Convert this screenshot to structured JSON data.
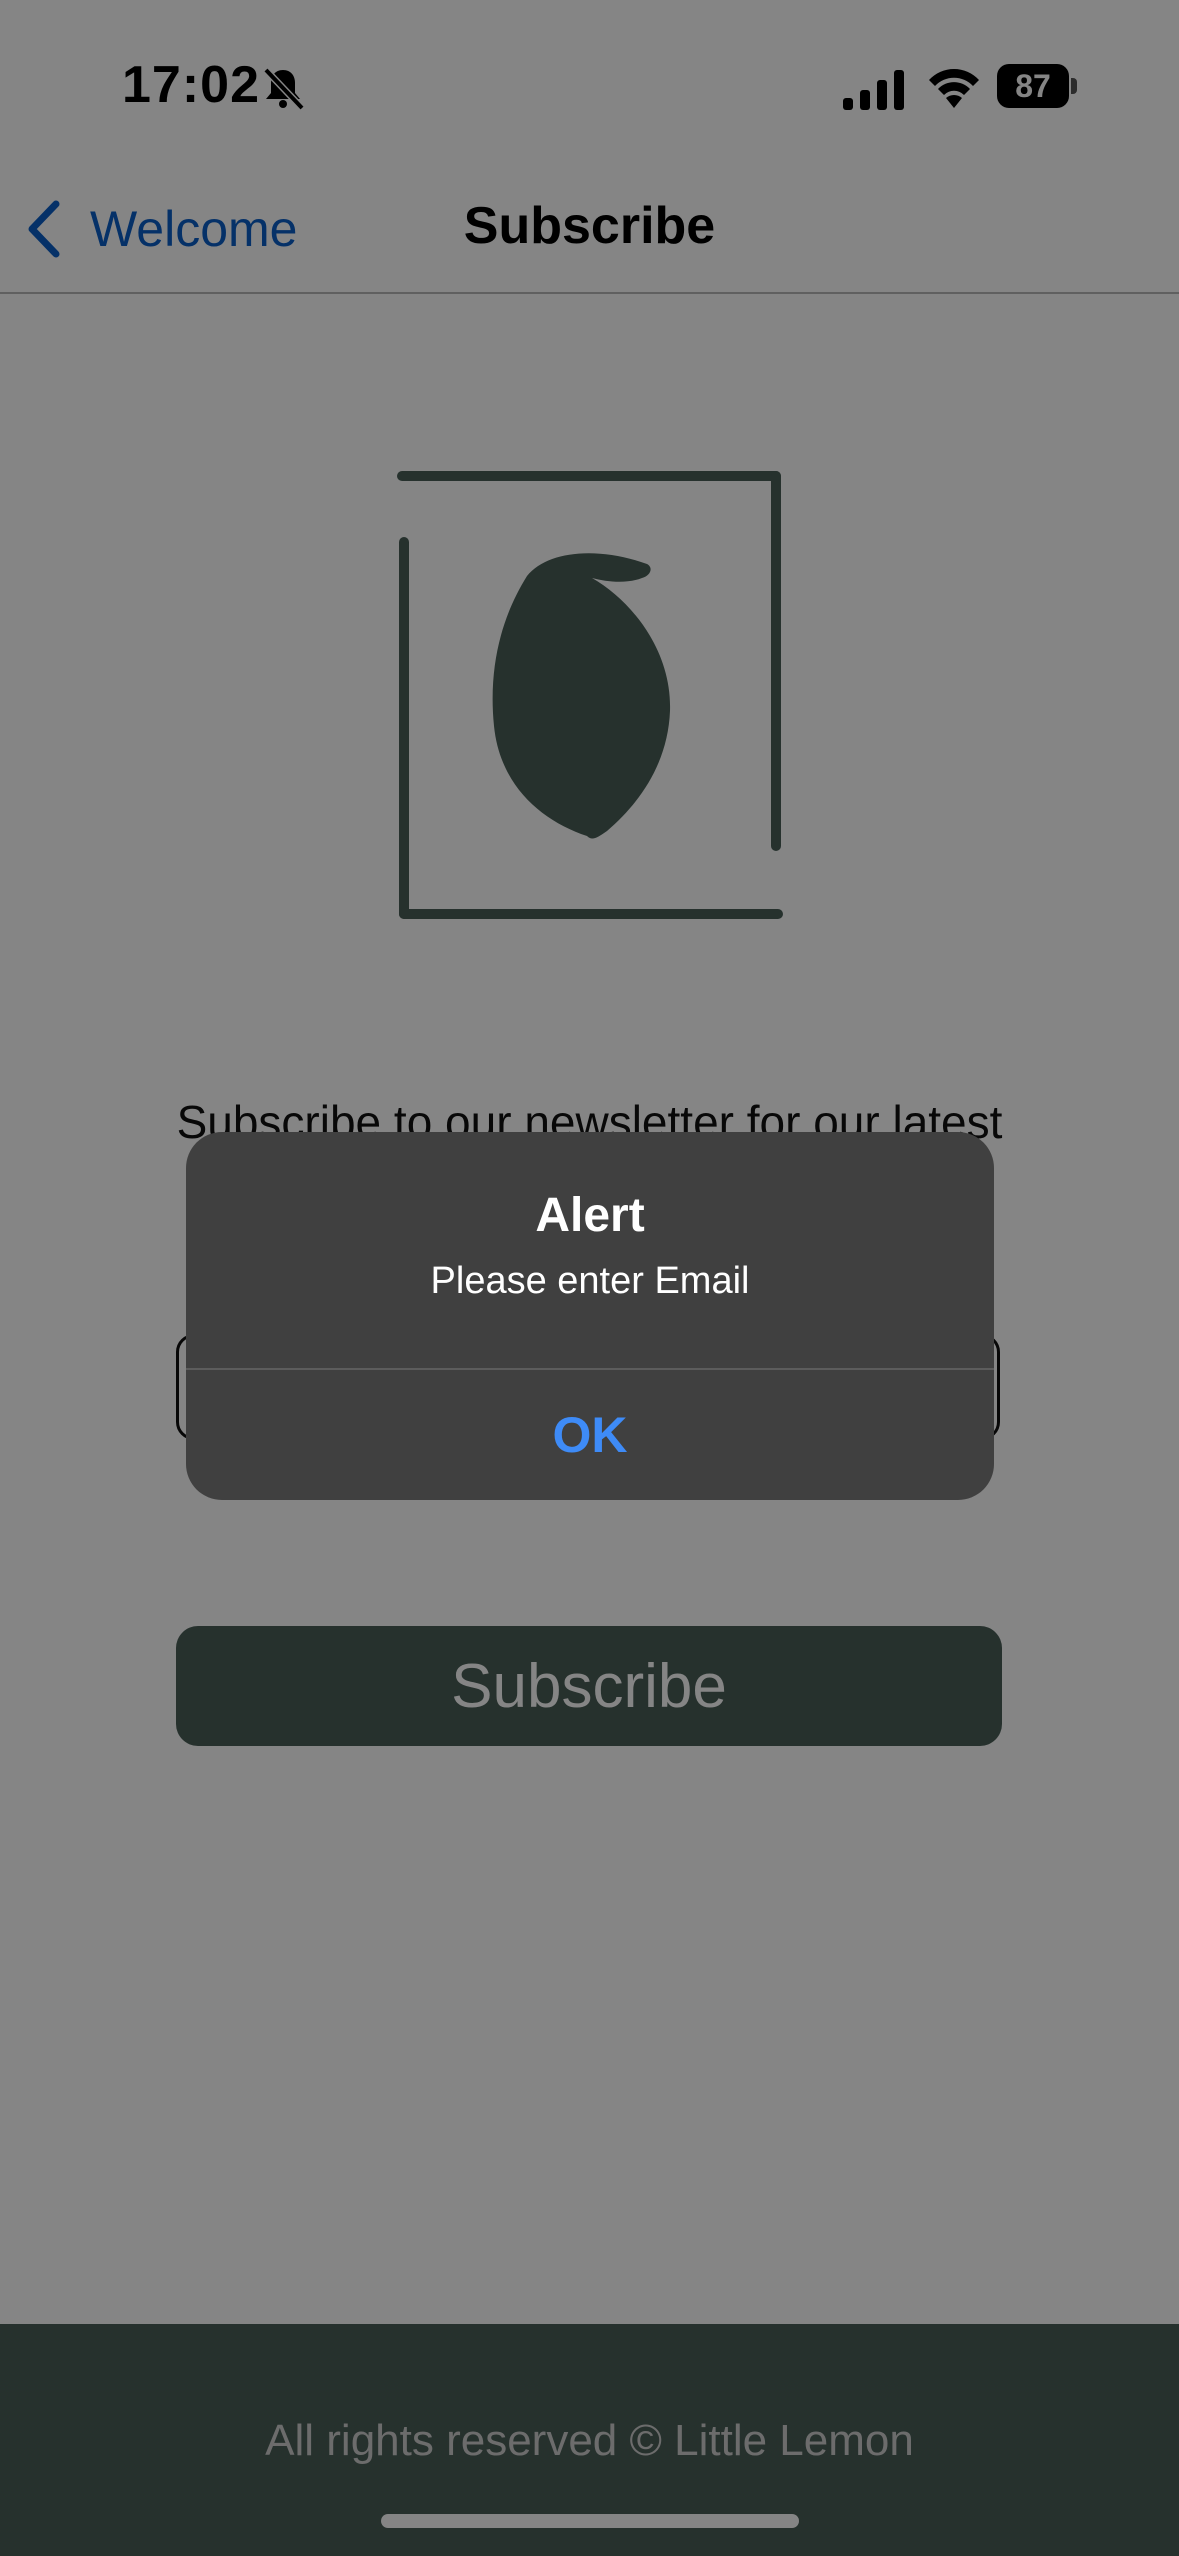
{
  "status_bar": {
    "time": "17:02",
    "battery": "87",
    "icons": [
      "bell-slash-icon",
      "signal-icon",
      "wifi-icon",
      "battery-icon"
    ]
  },
  "nav": {
    "back_label": "Welcome",
    "title": "Subscribe"
  },
  "content": {
    "intro_text": "Subscribe to our newsletter for our latest",
    "email_value": "",
    "subscribe_label": "Subscribe"
  },
  "footer": {
    "text": "All rights reserved © Little Lemon"
  },
  "alert": {
    "title": "Alert",
    "message": "Please enter Email",
    "ok_label": "OK"
  },
  "colors": {
    "brand_green": "#495e57",
    "link_blue": "#0a5ec7",
    "alert_button_blue": "#3e8bf7"
  }
}
